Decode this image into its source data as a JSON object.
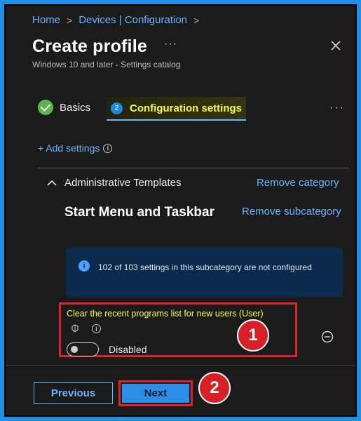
{
  "breadcrumb": {
    "home": "Home",
    "devices": "Devices | Configuration"
  },
  "header": {
    "title": "Create profile",
    "more": "···",
    "subtitle": "Windows 10 and later - Settings catalog"
  },
  "tabs": [
    {
      "label": "Basics",
      "status": "complete"
    },
    {
      "label": "Configuration settings",
      "step": "2",
      "status": "active"
    }
  ],
  "tabs_more": "···",
  "add_settings": {
    "label": "+ Add settings",
    "info": "i"
  },
  "category": {
    "title": "Administrative Templates",
    "remove_label": "Remove category",
    "subcategory": {
      "title": "Start Menu and Taskbar",
      "remove_label": "Remove subcategory"
    }
  },
  "info_banner": {
    "icon": "i",
    "text": "102 of 103 settings in this subcategory are not configured"
  },
  "setting": {
    "label": "Clear the recent programs list for new users (User)",
    "info": "i",
    "toggle_label": "Disabled",
    "enabled": false
  },
  "markers": [
    "1",
    "2"
  ],
  "footer": {
    "previous": "Previous",
    "next": "Next"
  },
  "colors": {
    "accent": "#6cb4ff",
    "highlight": "#f6ff3a",
    "marker": "#d81e26",
    "background": "#1b1b1b"
  }
}
